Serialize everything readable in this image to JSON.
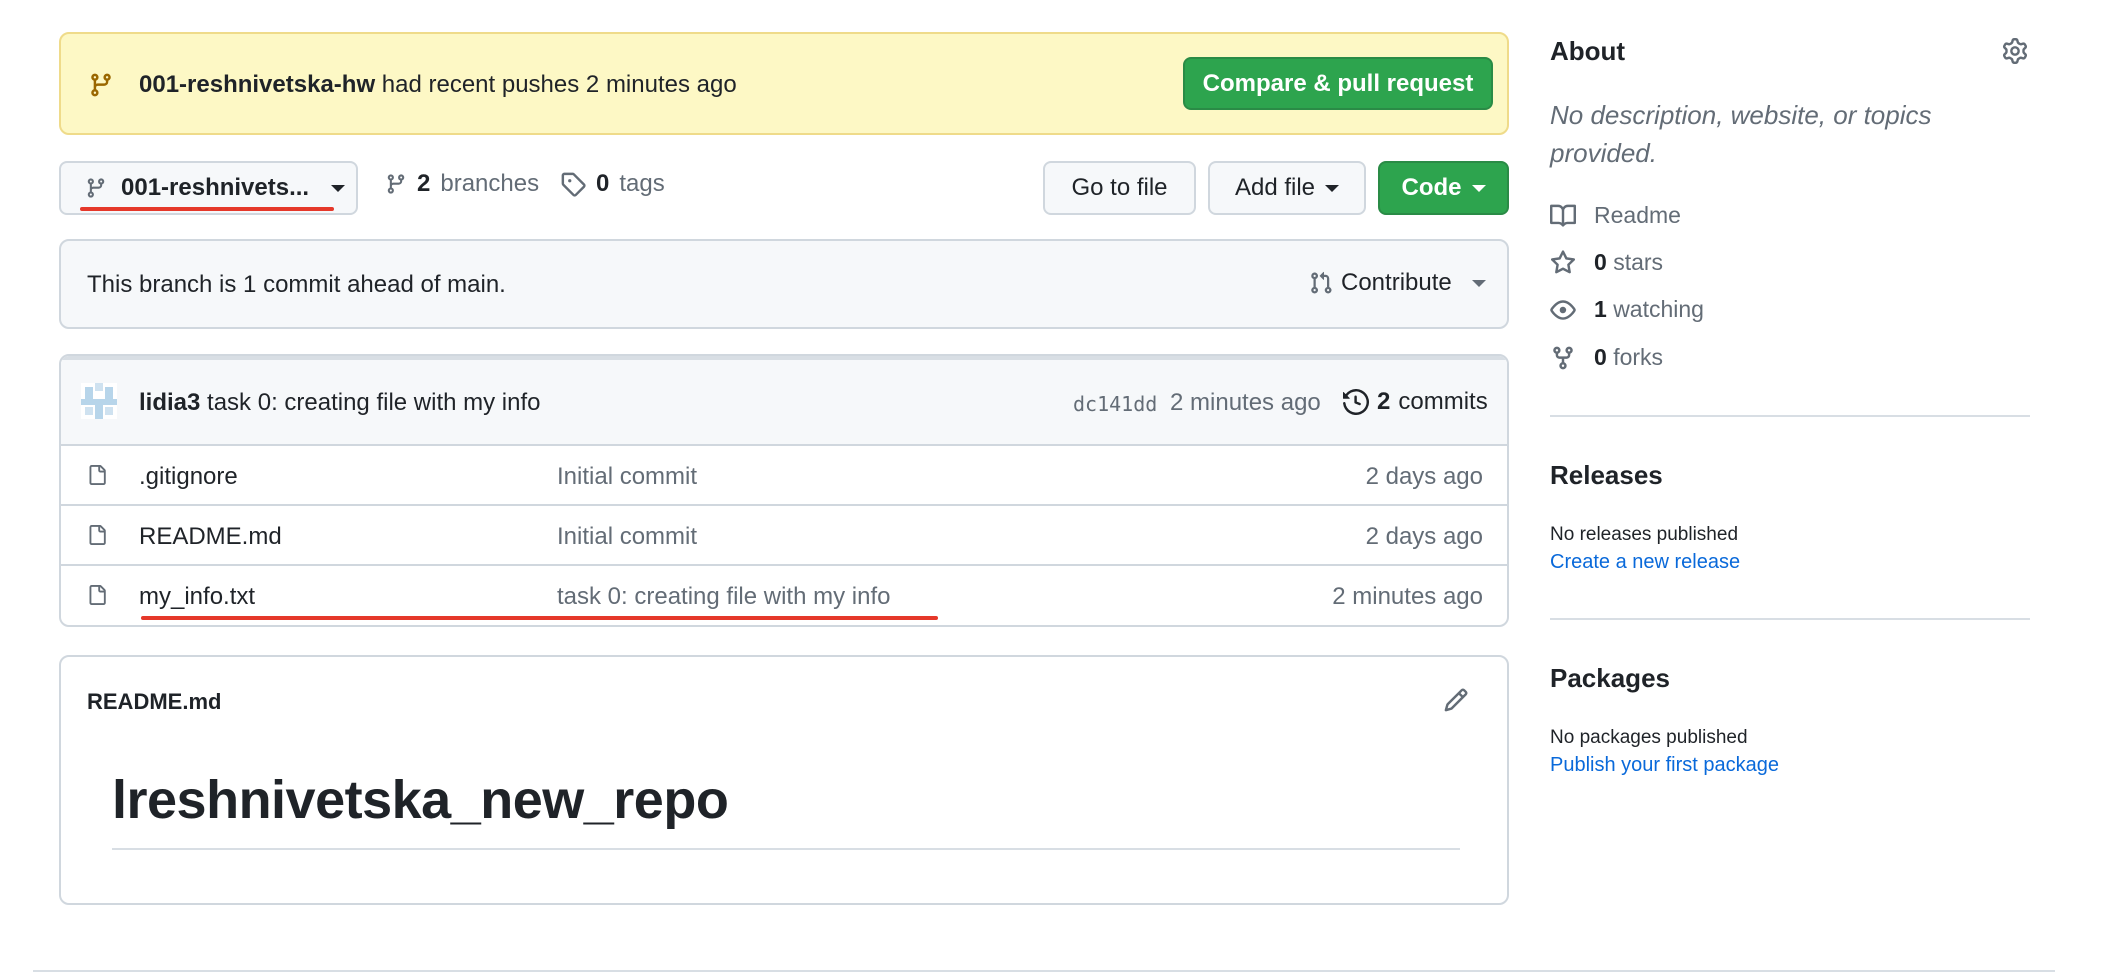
{
  "banner": {
    "branch": "001-reshnivetska-hw",
    "text": "had recent pushes 2 minutes ago",
    "compare_button": "Compare & pull request"
  },
  "toolbar": {
    "branch_selector": "001-reshnivets...",
    "branches_count": "2",
    "branches_label": "branches",
    "tags_count": "0",
    "tags_label": "tags",
    "go_to_file": "Go to file",
    "add_file": "Add file",
    "code": "Code"
  },
  "ahead": {
    "text": "This branch is 1 commit ahead of main.",
    "contribute": "Contribute"
  },
  "latest_commit": {
    "author": "lidia3",
    "message": "task 0: creating file with my info",
    "sha": "dc141dd",
    "time": "2 minutes ago",
    "commits_count": "2",
    "commits_label": "commits"
  },
  "files": [
    {
      "name": ".gitignore",
      "message": "Initial commit",
      "time": "2 days ago"
    },
    {
      "name": "README.md",
      "message": "Initial commit",
      "time": "2 days ago"
    },
    {
      "name": "my_info.txt",
      "message": "task 0: creating file with my info",
      "time": "2 minutes ago"
    }
  ],
  "readme": {
    "filename": "README.md",
    "heading": "lreshnivetska_new_repo"
  },
  "sidebar": {
    "about_title": "About",
    "description": "No description, website, or topics provided.",
    "readme_label": "Readme",
    "stars_count": "0",
    "stars_label": "stars",
    "watching_count": "1",
    "watching_label": "watching",
    "forks_count": "0",
    "forks_label": "forks",
    "releases_title": "Releases",
    "releases_note": "No releases published",
    "releases_link": "Create a new release",
    "packages_title": "Packages",
    "packages_note": "No packages published",
    "packages_link": "Publish your first package"
  },
  "colors": {
    "accent_green": "#2da44e",
    "link_blue": "#0969da",
    "annotation_red": "#e5382a",
    "banner_yellow": "#fdf8c5"
  }
}
